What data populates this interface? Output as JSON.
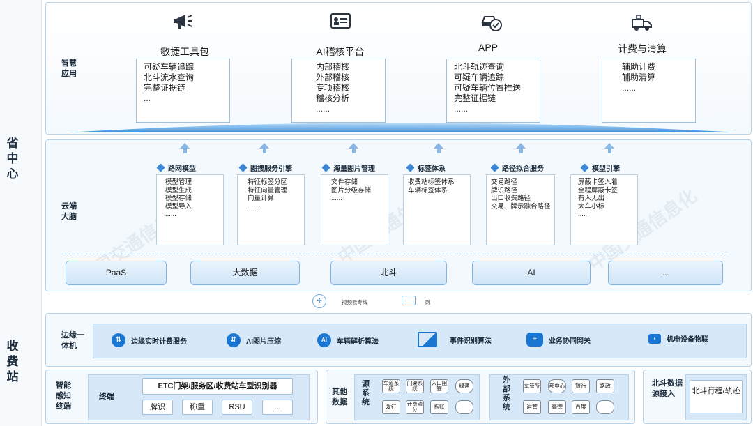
{
  "sections": {
    "province_center": "省中心",
    "toll_station": "收费站"
  },
  "smart_apps": {
    "label": "智慧应用",
    "items": [
      {
        "title": "敏捷工具包",
        "icon": "megaphone-icon",
        "lines": [
          "可疑车辆追踪",
          "北斗流水查询",
          "完整证据链",
          "..."
        ]
      },
      {
        "title": "AI稽核平台",
        "icon": "id-card-icon",
        "lines": [
          "内部稽核",
          "外部稽核",
          "专项稽核",
          "稽核分析",
          "......"
        ]
      },
      {
        "title": "APP",
        "icon": "car-check-icon",
        "lines": [
          "北斗轨迹查询",
          "可疑车辆追踪",
          "可疑车辆位置推送",
          "完整证据链",
          "......"
        ]
      },
      {
        "title": "计费与清算",
        "icon": "truck-icon",
        "lines": [
          "辅助计费",
          "辅助清算",
          "......"
        ]
      }
    ]
  },
  "cloud_brain": {
    "label": "云端大脑",
    "modules": [
      {
        "title": "路网模型",
        "lines": [
          "模型管理",
          "模型生成",
          "模型存储",
          "模型导入",
          "......"
        ]
      },
      {
        "title": "图搜服务引擎",
        "lines": [
          "特征标签分区",
          "特征向量管理",
          "向量计算",
          "......"
        ]
      },
      {
        "title": "海量图片管理",
        "lines": [
          "文件存储",
          "图片分级存储",
          "......"
        ]
      },
      {
        "title": "标签体系",
        "lines": [
          "收费站标签体系",
          "车辆标签体系"
        ]
      },
      {
        "title": "路径拟合服务",
        "lines": [
          "交易路径",
          "牌识路径",
          "出口收费路径",
          "交易、牌示融合路径"
        ]
      },
      {
        "title": "模型引擎",
        "lines": [
          "屏蔽卡签入着",
          "全程屏蔽卡签",
          "有入无出",
          "大车小标",
          "......"
        ]
      }
    ],
    "base": [
      "PaaS",
      "大数据",
      "北斗",
      "AI",
      "..."
    ]
  },
  "network": {
    "video_cloud": "视频云专线",
    "net": "网"
  },
  "edge": {
    "label": "边缘一体机",
    "items": [
      {
        "label": "边缘实时计费服务",
        "icon": "billing-icon"
      },
      {
        "label": "AI图片压缩",
        "icon": "compress-icon"
      },
      {
        "label": "车辆解析算法",
        "icon": "ai-icon"
      },
      {
        "label": "事件识别算法",
        "icon": "image-icon"
      },
      {
        "label": "业务协同网关",
        "icon": "gateway-icon"
      },
      {
        "label": "机电设备物联",
        "icon": "router-icon"
      }
    ]
  },
  "terminal": {
    "label": "智能感知终端",
    "sub_label": "终端",
    "header": "ETC门架/服务区/收费站车型识别器",
    "cells": [
      "牌识",
      "称重",
      "RSU",
      "..."
    ]
  },
  "other_data": {
    "label": "其他数据",
    "source": {
      "label": "源系统",
      "tags": [
        "车道系统",
        "门架系统",
        "入口阻塞",
        "绿通",
        "发行",
        "计费清分",
        "拆账",
        ""
      ]
    },
    "external": {
      "label": "外部系统",
      "tags": [
        "车管所",
        "部中心",
        "银行",
        "路政",
        "运管",
        "高德",
        "百度",
        ""
      ]
    }
  },
  "beidou": {
    "label": "北斗数据源接入",
    "box": "北斗行程/轨迹"
  },
  "watermark": "中国交通信息化"
}
